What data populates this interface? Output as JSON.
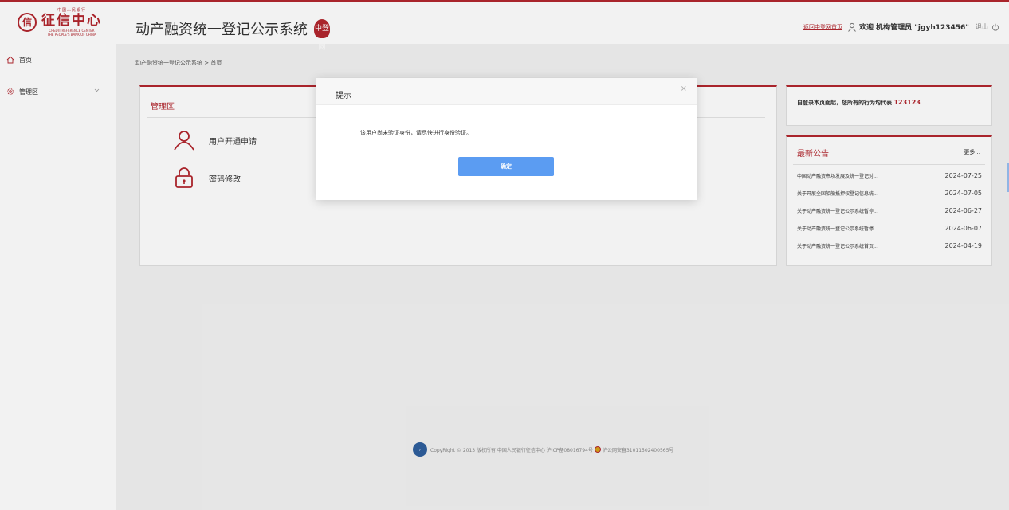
{
  "header": {
    "logo": {
      "small_text": "中国人民银行",
      "main_text": "征信中心",
      "en_line1": "CREDIT REFERENCE CENTER",
      "en_line2": "THE PEOPLE'S BANK OF CHINA"
    },
    "system_title": "动产融资统一登记公示系统",
    "stamp_text": "中登网",
    "home_link": "返回中登网首页",
    "welcome": "欢迎 机构管理员 \"jgyh123456\"",
    "logout": "退出"
  },
  "sidebar": {
    "items": [
      {
        "label": "首页",
        "icon": "home-icon"
      },
      {
        "label": "管理区",
        "icon": "gear-icon"
      }
    ]
  },
  "breadcrumb": "动产融资统一登记公示系统 > 首页",
  "management": {
    "title": "管理区",
    "entries": [
      {
        "label": "用户开通申请",
        "icon": "user-icon"
      },
      {
        "label": "密码修改",
        "icon": "lock-icon"
      }
    ]
  },
  "info": {
    "text": "自登录本页面起，您所有的行为均代表",
    "code": "123123"
  },
  "notices": {
    "title": "最新公告",
    "more": "更多...",
    "items": [
      {
        "title": "中国动产融资市场发展及统一登记对...",
        "date": "2024-07-25"
      },
      {
        "title": "关于开展全国船舶抵押权登记信息统...",
        "date": "2024-07-05"
      },
      {
        "title": "关于动产融资统一登记公示系统暂停...",
        "date": "2024-06-27"
      },
      {
        "title": "关于动产融资统一登记公示系统暂停...",
        "date": "2024-06-07"
      },
      {
        "title": "关于动产融资统一登记公示系统首页...",
        "date": "2024-04-19"
      }
    ]
  },
  "footer": {
    "copyright": "CopyRight © 2013 版权所有 中国人民银行征信中心 沪ICP备08016794号",
    "police": "沪公网安备31011502400565号"
  },
  "modal": {
    "title": "提示",
    "message": "该用户尚未验证身份，请尽快进行身份验证。",
    "ok_label": "确定",
    "close": "×"
  },
  "colors": {
    "brand_red": "#b3262e",
    "button_blue": "#5b9cf2"
  }
}
